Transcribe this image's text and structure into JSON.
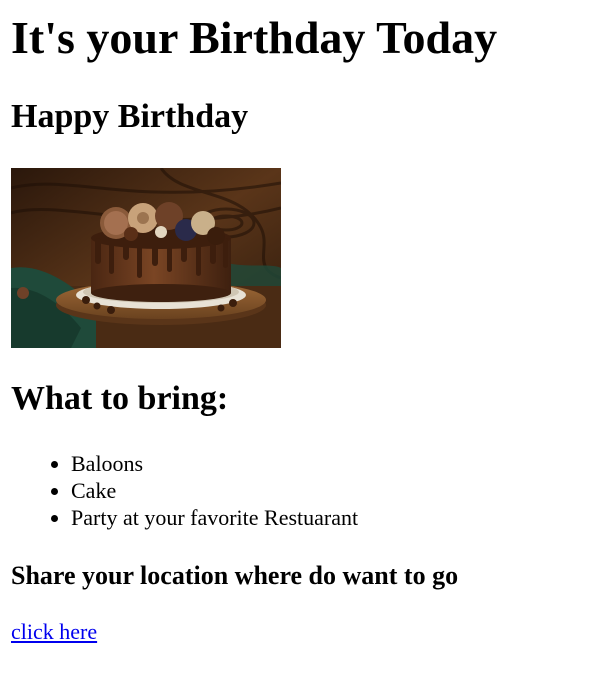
{
  "heading": "It's your Birthday Today",
  "subheading": "Happy Birthday",
  "image": {
    "subject": "chocolate-birthday-cake",
    "colors": {
      "wood_dark": "#2a170b",
      "wood_mid": "#5a3519",
      "cake": "#6b3a1e",
      "drip": "#3d1e0d",
      "board": "#8a5a2e",
      "plate": "#e8e2d6",
      "cloth": "#1f4a3a"
    }
  },
  "bring_heading": "What to bring:",
  "items": [
    "Baloons",
    "Cake",
    "Party at your favorite Restuarant"
  ],
  "share_heading": "Share your location where do want to go",
  "link": {
    "label": "click here",
    "color": "#0000ee"
  }
}
